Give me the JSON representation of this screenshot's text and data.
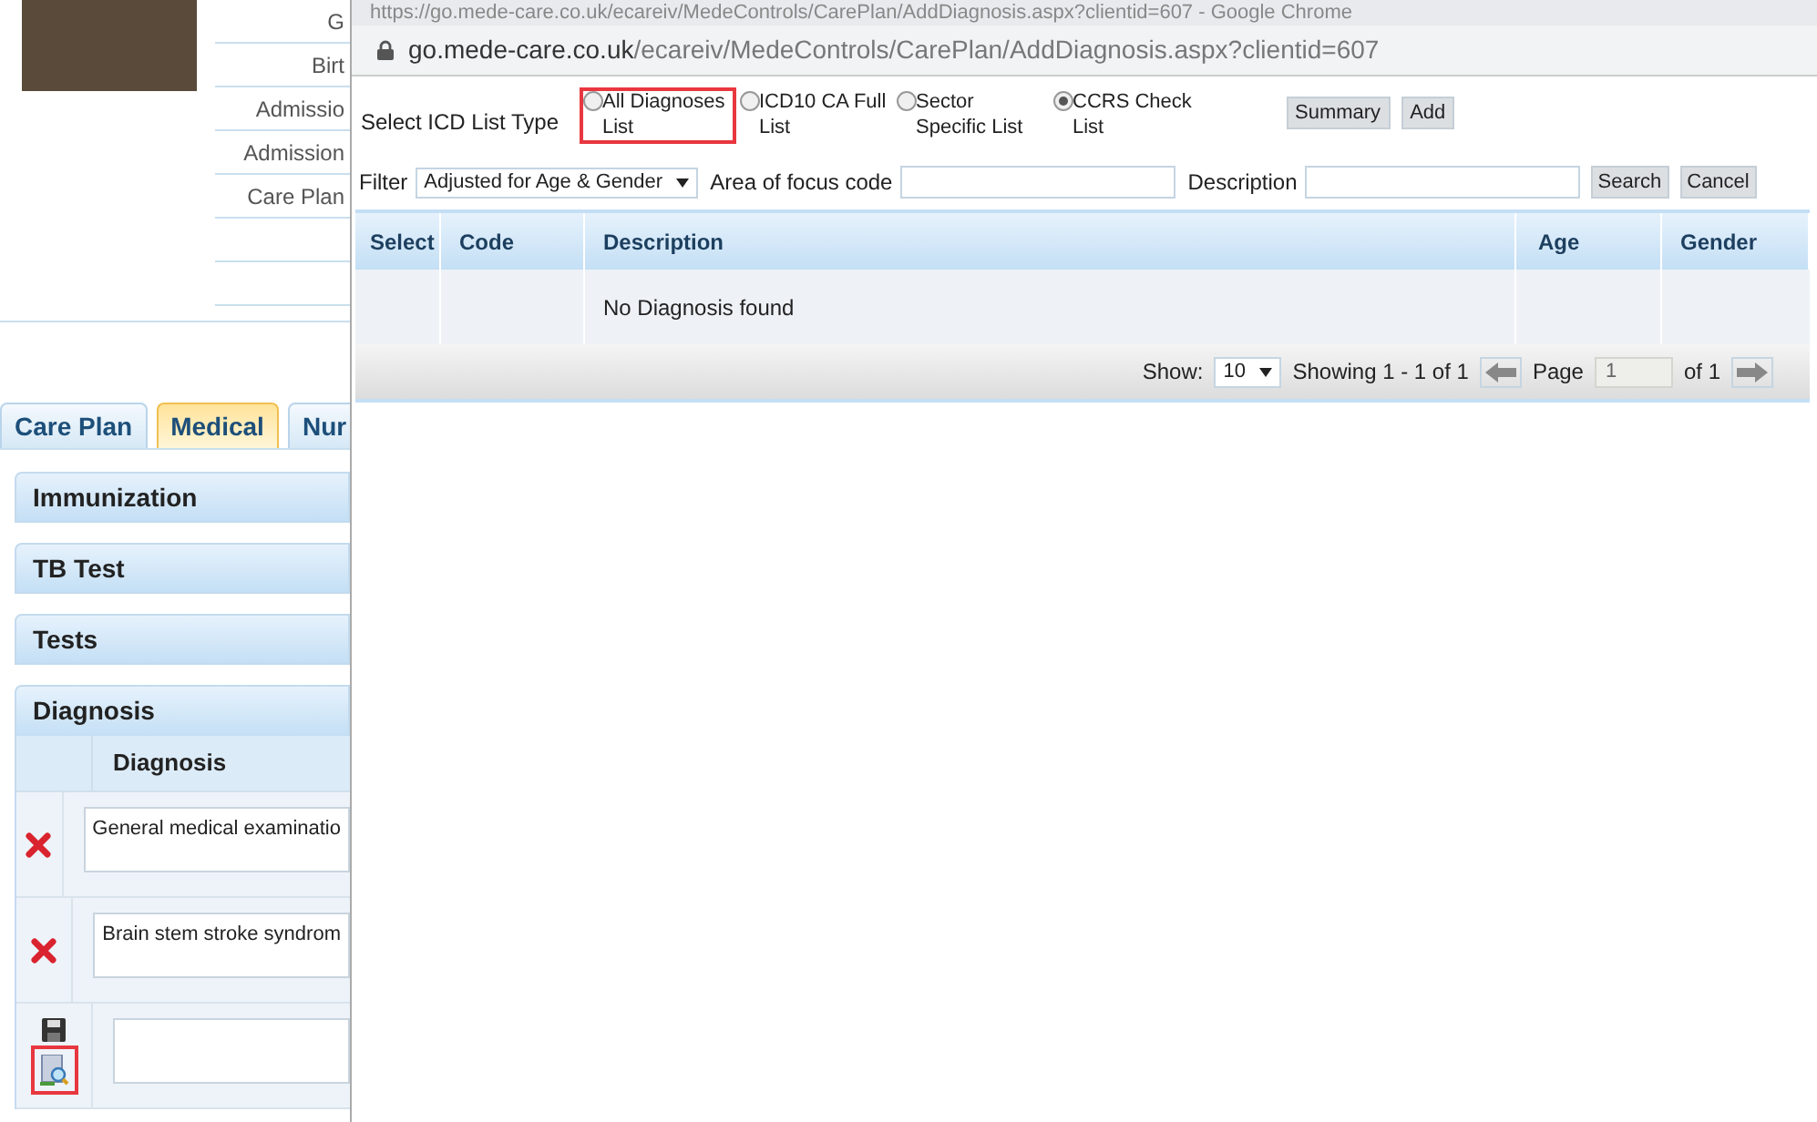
{
  "background_page": {
    "info_labels": [
      "G",
      "Birt",
      "Admissio",
      "Admission",
      "Care Plan"
    ],
    "tabs": [
      {
        "label": "Care Plan",
        "selected": false
      },
      {
        "label": "Medical",
        "selected": true
      },
      {
        "label": "Nur",
        "selected": false
      }
    ],
    "sections": [
      {
        "title": "Immunization",
        "expanded": false
      },
      {
        "title": "TB Test",
        "expanded": false
      },
      {
        "title": "Tests",
        "expanded": false
      },
      {
        "title": "Diagnosis",
        "expanded": true
      }
    ],
    "diagnosis_table": {
      "column": "Diagnosis",
      "rows": [
        {
          "kind": "existing",
          "text": "General medical examinatio"
        },
        {
          "kind": "existing",
          "text": "Brain stem stroke syndrom"
        },
        {
          "kind": "new",
          "text": "",
          "highlighted": true
        }
      ]
    }
  },
  "popup": {
    "title": "https://go.mede-care.co.uk/ecareiv/MedeControls/CarePlan/AddDiagnosis.aspx?clientid=607 - Google Chrome",
    "address": {
      "domain": "go.mede-care.co.uk",
      "path": "/ecareiv/MedeControls/CarePlan/AddDiagnosis.aspx?clientid=607"
    },
    "list_type_label": "Select ICD List Type",
    "list_types": [
      {
        "label": "All Diagnoses List",
        "selected": false,
        "highlighted": true
      },
      {
        "label": "ICD10 CA Full List",
        "selected": false,
        "highlighted": false
      },
      {
        "label": "Sector Specific List",
        "selected": false,
        "highlighted": false
      },
      {
        "label": "CCRS Check List",
        "selected": true,
        "highlighted": false
      }
    ],
    "buttons": [
      "Summary",
      "Add"
    ],
    "filter_label": "Filter",
    "filter_value": "Adjusted for Age & Gender",
    "area_label": "Area of focus code",
    "description_label": "Description",
    "search_buttons": [
      "Search",
      "Cancel"
    ],
    "table": {
      "columns": [
        "Select",
        "Code",
        "Description",
        "Age",
        "Gender"
      ],
      "empty_message": "No Diagnosis found"
    },
    "pager": {
      "show_label": "Show:",
      "page_size": "10",
      "showing": "Showing 1 - 1 of 1",
      "page_label": "Page",
      "page": "1",
      "of": "of 1"
    }
  }
}
